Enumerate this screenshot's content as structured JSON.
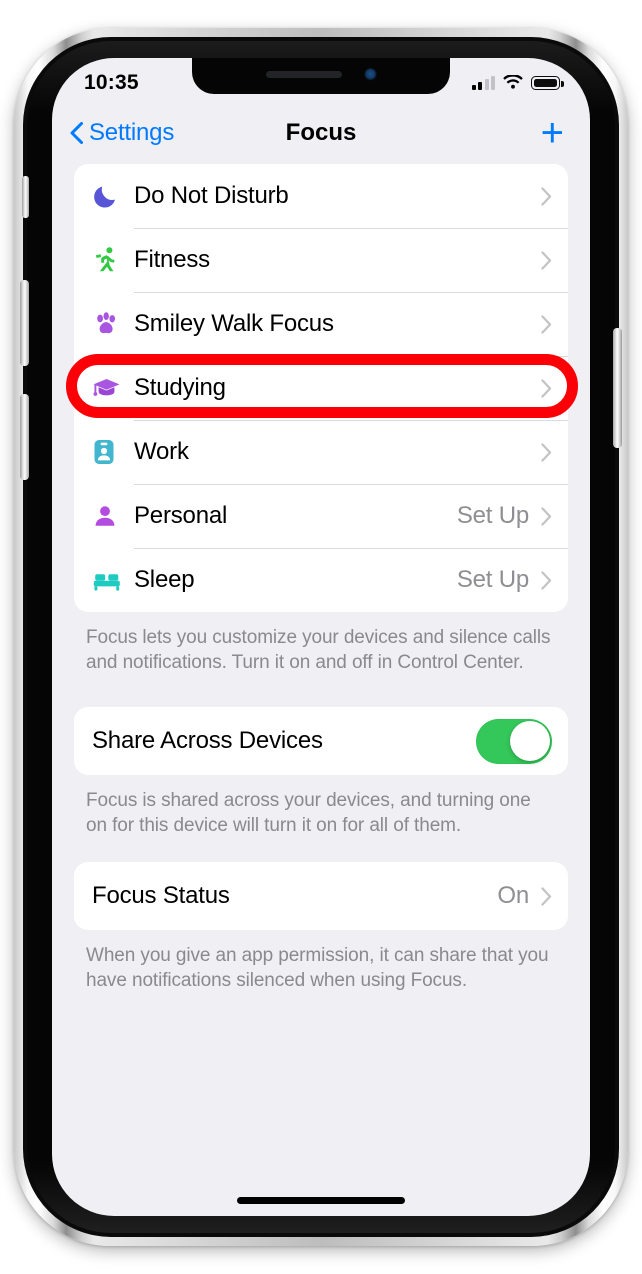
{
  "status_bar": {
    "time": "10:35",
    "signal_icon": "cellular-bars-icon",
    "signal_bars_filled": 2,
    "signal_bars_total": 4,
    "wifi_icon": "wifi-icon",
    "battery_icon": "battery-full-icon"
  },
  "nav": {
    "back_icon": "chevron-left-icon",
    "back_label": "Settings",
    "title": "Focus",
    "add_icon": "plus-icon",
    "add_label": "+"
  },
  "focus_list": [
    {
      "icon": "moon-icon",
      "label": "Do Not Disturb",
      "value": "",
      "chevron": "chevron-right-icon",
      "color": "#5856d6"
    },
    {
      "icon": "running-person-icon",
      "label": "Fitness",
      "value": "",
      "chevron": "chevron-right-icon",
      "color": "#30c940"
    },
    {
      "icon": "paw-print-icon",
      "label": "Smiley Walk Focus",
      "value": "",
      "chevron": "chevron-right-icon",
      "color": "#a855e0"
    },
    {
      "icon": "graduation-cap-icon",
      "label": "Studying",
      "value": "",
      "chevron": "chevron-right-icon",
      "color": "#a855e0"
    },
    {
      "icon": "id-badge-icon",
      "label": "Work",
      "value": "",
      "chevron": "chevron-right-icon",
      "color": "#41b6ce"
    },
    {
      "icon": "person-icon",
      "label": "Personal",
      "value": "Set Up",
      "chevron": "chevron-right-icon",
      "color": "#b44ce0"
    },
    {
      "icon": "bed-icon",
      "label": "Sleep",
      "value": "Set Up",
      "chevron": "chevron-right-icon",
      "color": "#1ecbc0"
    }
  ],
  "focus_footnote": "Focus lets you customize your devices and silence calls and notifications. Turn it on and off in Control Center.",
  "share_row": {
    "label": "Share Across Devices",
    "toggle_state": "on",
    "toggle_color": "#34c759"
  },
  "share_footnote": "Focus is shared across your devices, and turning one on for this device will turn it on for all of them.",
  "status_row": {
    "label": "Focus Status",
    "value": "On",
    "chevron": "chevron-right-icon"
  },
  "status_footnote": "When you give an app permission, it can share that you have notifications silenced when using Focus.",
  "annotation": {
    "type": "highlight-oval",
    "target": "Smiley Walk Focus",
    "color": "#fb0007"
  },
  "accent_color": "#007aff"
}
